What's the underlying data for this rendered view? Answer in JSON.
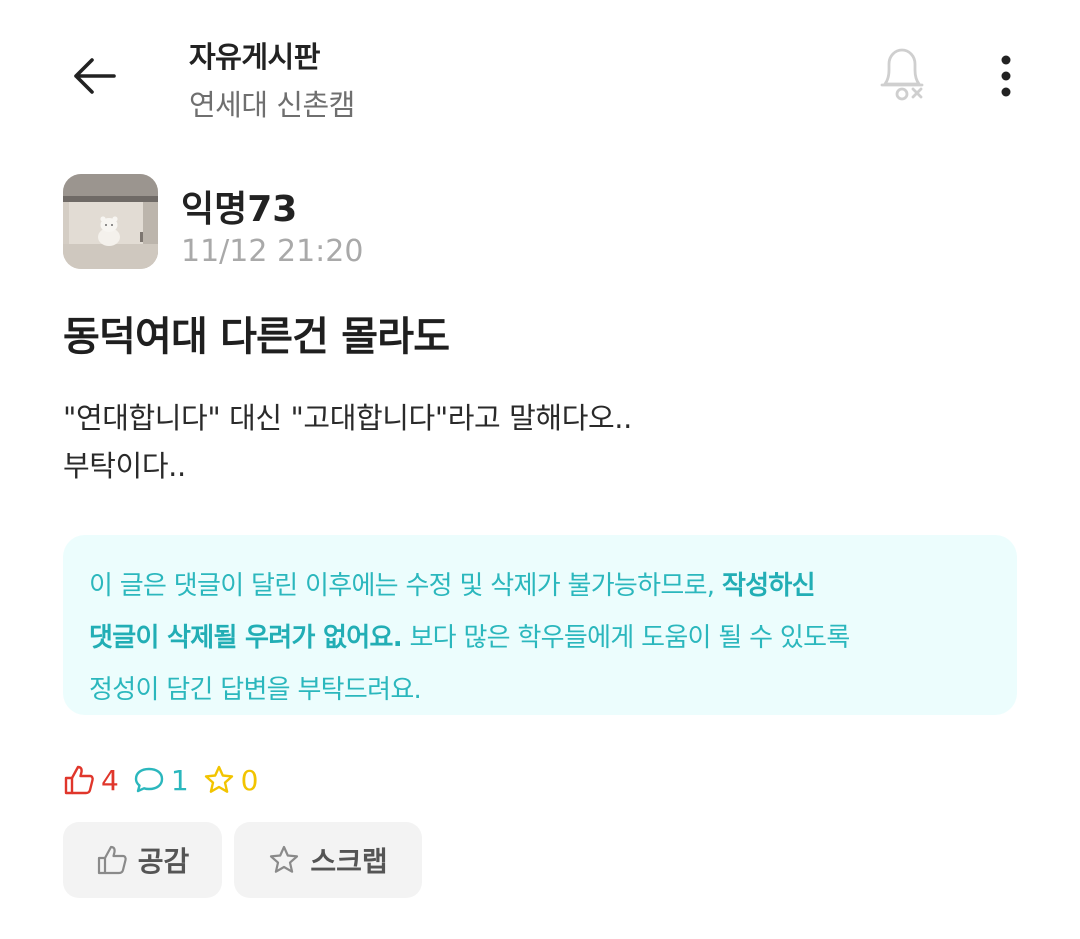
{
  "header": {
    "back_icon": "arrow-left-icon",
    "title": "자유게시판",
    "subtitle": "연세대 신촌캠",
    "notification_icon": "bell-off-icon",
    "more_icon": "more-vertical-icon"
  },
  "post": {
    "author": "익명73",
    "timestamp": "11/12 21:20",
    "title": "동덕여대 다른건 몰라도",
    "body_lines": [
      "\"연대합니다\" 대신 \"고대합니다\"라고 말해다오..",
      "부탁이다.."
    ]
  },
  "notice": {
    "line1_normal": "이 글은 댓글이 달린 이후에는 수정 및 삭제가 불가능하므로, ",
    "line1_bold": "작성하신",
    "line2_bold": "댓글이 삭제될 우려가 없어요.",
    "line2_normal": " 보다 많은 학우들에게 도움이 될 수 있도록",
    "line3_normal": "정성이 담긴 답변을 부탁드려요."
  },
  "stats": {
    "likes": "4",
    "comments": "1",
    "scraps": "0"
  },
  "actions": {
    "like_label": "공감",
    "scrap_label": "스크랩"
  },
  "colors": {
    "accent_teal": "#2bb7bd",
    "notice_bg": "#ecfdfd",
    "like_red": "#e0362b",
    "scrap_yellow": "#f2c400",
    "muted_gray": "#a9a9a9"
  }
}
